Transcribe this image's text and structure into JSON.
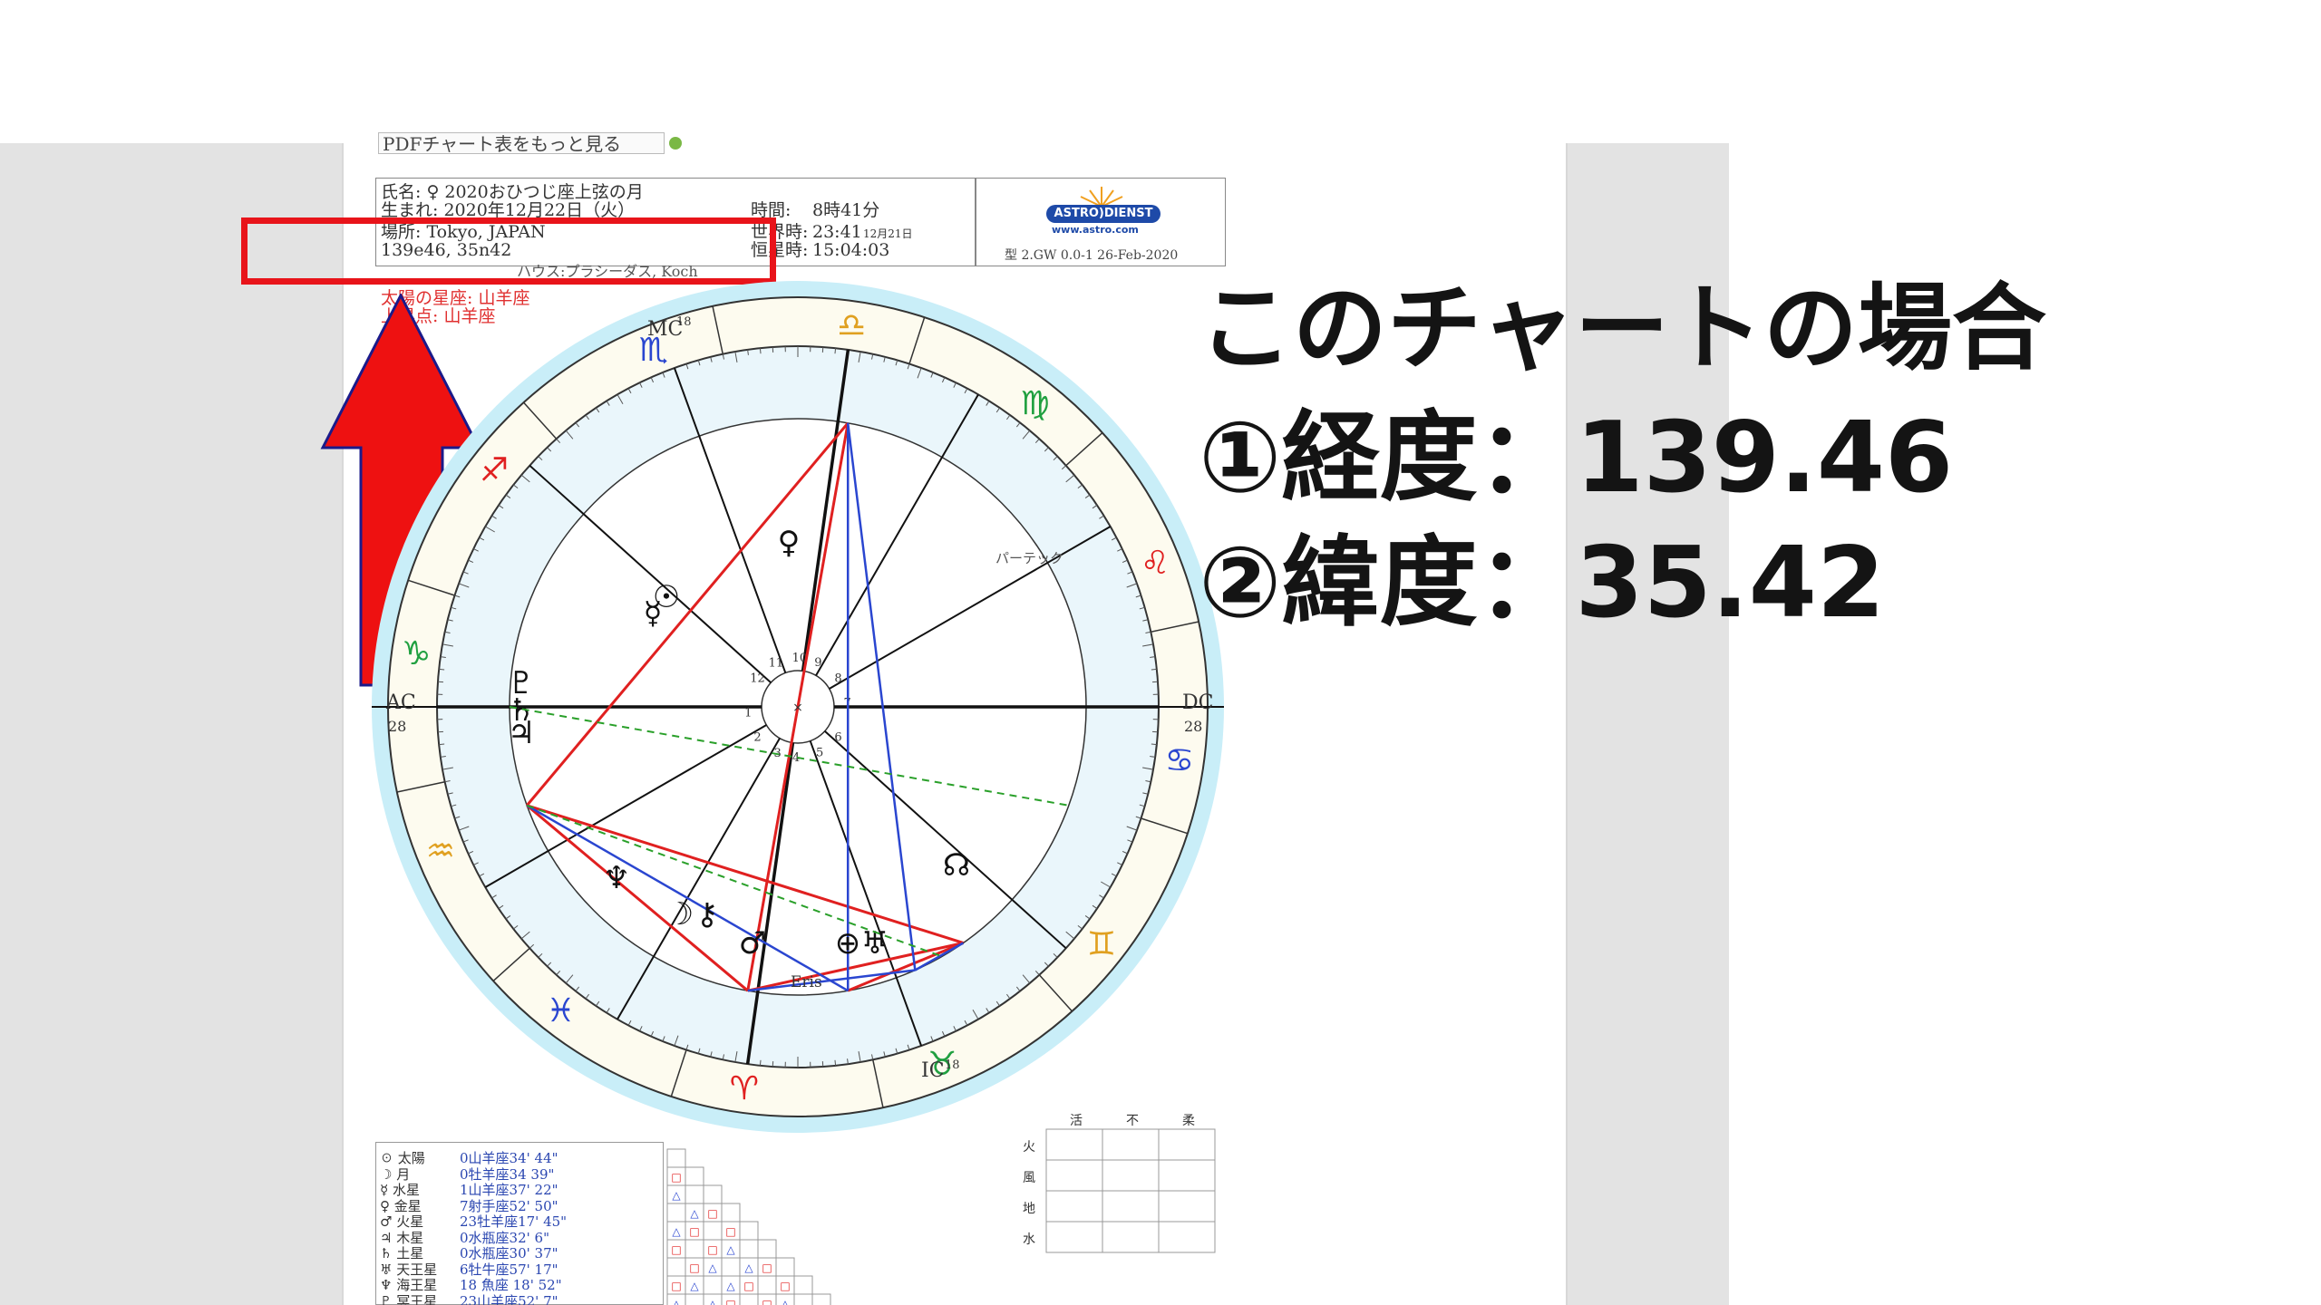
{
  "header": {
    "toolbar_label": "PDFチャート表をもっと見る",
    "name_line": "氏名: ♀ 2020おひつじ座上弦の月",
    "birth_line": "生まれ: 2020年12月22日（火）",
    "place_line": "場所: Tokyo, JAPAN",
    "coords": "139e46, 35n42",
    "time_label": "時間:",
    "time_value": "8時41分",
    "local_label": "世界時:",
    "local_value": "23:41",
    "local_date": "12月21日",
    "sidereal_label": "恒星時:",
    "sidereal_value": "15:04:03",
    "house_system_line": "ハウス:プラシーダス, Koch",
    "footer_code": "型 2.GW  0.0-1  26-Feb-2020",
    "logo_text": "ASTRO)DIENST",
    "logo_url": "www.astro.com",
    "sun_sign_note": "太陽の星座: 山羊座",
    "asc_note": "上昇点: 山羊座"
  },
  "chart": {
    "mc_label": "MC",
    "mc_deg": "18",
    "ic_label": "IC",
    "ic_deg": "18",
    "ac_label": "AC",
    "ac_deg": "28",
    "dc_label": "DC",
    "dc_deg": "28",
    "part_label": "パーテック",
    "eris_label": "Eris"
  },
  "overlay": {
    "line1": "このチャートの場合",
    "line2": "①経度：139.46",
    "line3": "②緯度：35.42"
  },
  "planets": [
    {
      "glyph": "☉",
      "name": "太陽",
      "pos": "0山羊座34' 44\""
    },
    {
      "glyph": "☽",
      "name": "月",
      "pos": "0牡羊座34 39\""
    },
    {
      "glyph": "☿",
      "name": "水星",
      "pos": "1山羊座37' 22\""
    },
    {
      "glyph": "♀",
      "name": "金星",
      "pos": "7射手座52' 50\""
    },
    {
      "glyph": "♂",
      "name": "火星",
      "pos": "23牡羊座17' 45\""
    },
    {
      "glyph": "♃",
      "name": "木星",
      "pos": "0水瓶座32' 6\""
    },
    {
      "glyph": "♄",
      "name": "土星",
      "pos": "0水瓶座30' 37\""
    },
    {
      "glyph": "♅",
      "name": "天王星",
      "pos": "6牡牛座57' 17\""
    },
    {
      "glyph": "♆",
      "name": "海王星",
      "pos": "18 魚座 18' 52\""
    },
    {
      "glyph": "♇",
      "name": "冥王星",
      "pos": "23山羊座52' 7\""
    }
  ],
  "elements": {
    "col_headers": [
      "活",
      "不",
      "柔"
    ],
    "row_headers": [
      "火",
      "風",
      "地",
      "水"
    ]
  },
  "colors": {
    "highlight_red": "#e8141a",
    "arrow_red": "#ee1111",
    "ring_cyan": "#c9eef8",
    "aspect_red": "#e02020",
    "aspect_blue": "#2a46d0",
    "aspect_green": "#2aa02a"
  }
}
